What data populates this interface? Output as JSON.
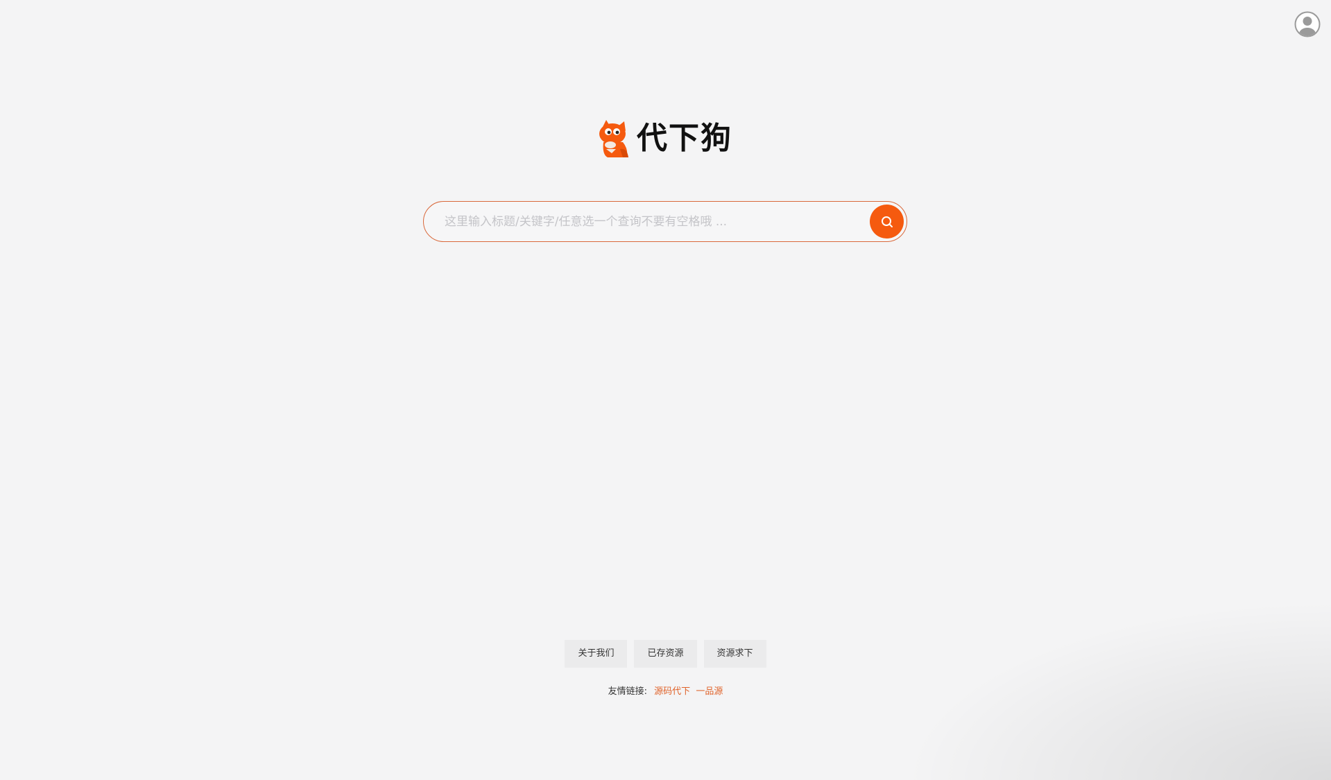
{
  "header": {
    "avatar_icon": "user-avatar-icon"
  },
  "logo": {
    "text": "代下狗",
    "mark_icon": "fox-mascot-icon",
    "brand_color": "#f55a0f"
  },
  "search": {
    "placeholder": "这里输入标题/关键字/任意选一个查询不要有空格哦 ...",
    "value": "",
    "button_icon": "search-icon",
    "border_color": "#d9683a"
  },
  "footer": {
    "nav": [
      {
        "label": "关于我们"
      },
      {
        "label": "已存资源"
      },
      {
        "label": "资源求下"
      }
    ],
    "friend_links_label": "友情链接:",
    "friend_links": [
      {
        "label": "源码代下"
      },
      {
        "label": "一品源"
      }
    ],
    "link_color": "#e0632a"
  }
}
